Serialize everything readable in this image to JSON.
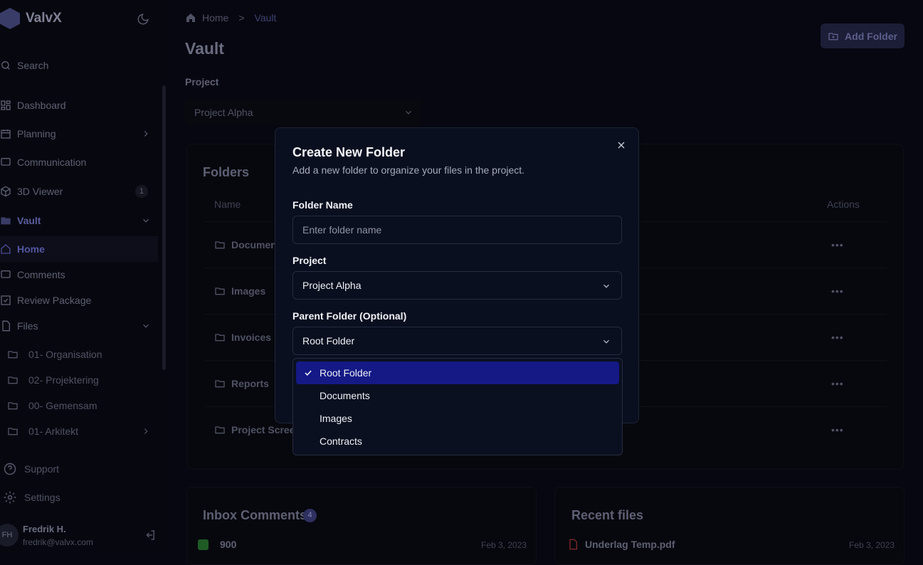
{
  "brand": {
    "name": "ValvX"
  },
  "sidebar": {
    "search_placeholder": "Search",
    "items": [
      {
        "label": "Dashboard"
      },
      {
        "label": "Planning"
      },
      {
        "label": "Communication"
      },
      {
        "label": "3D Viewer",
        "badge": "1"
      },
      {
        "label": "Vault"
      },
      {
        "label": "Home"
      },
      {
        "label": "Comments"
      },
      {
        "label": "Review Package"
      },
      {
        "label": "Files"
      }
    ],
    "file_folders": [
      {
        "label": "01- Organisation"
      },
      {
        "label": "02- Projektering"
      },
      {
        "label": "00- Gemensam"
      },
      {
        "label": "01- Arkitekt"
      }
    ],
    "footer": [
      {
        "label": "Support"
      },
      {
        "label": "Settings"
      }
    ],
    "user": {
      "initials": "FH",
      "name": "Fredrik H.",
      "email": "fredrik@valvx.com"
    }
  },
  "breadcrumb": {
    "home": "Home",
    "separator": ">",
    "current": "Vault"
  },
  "page": {
    "title": "Vault",
    "add_folder_label": "Add Folder",
    "project_label": "Project",
    "project_value": "Project Alpha"
  },
  "folders": {
    "title": "Folders",
    "col_name": "Name",
    "col_actions": "Actions",
    "rows": [
      {
        "name": "Documen"
      },
      {
        "name": "Images"
      },
      {
        "name": "Invoices"
      },
      {
        "name": "Reports"
      },
      {
        "name": "Project Screer"
      }
    ],
    "row_actions": "•••"
  },
  "inbox": {
    "title": "Inbox Comments",
    "count": "4",
    "rows": [
      {
        "text": "900",
        "date": "Feb 3, 2023"
      }
    ]
  },
  "recent": {
    "title": "Recent files",
    "rows": [
      {
        "text": "Underlag Temp.pdf",
        "date": "Feb 3, 2023"
      }
    ]
  },
  "modal": {
    "title": "Create New Folder",
    "subtitle": "Add a new folder to organize your files in the project.",
    "folder_name_label": "Folder Name",
    "folder_name_placeholder": "Enter folder name",
    "project_label": "Project",
    "project_value": "Project Alpha",
    "parent_label": "Parent Folder (Optional)",
    "parent_value": "Root Folder",
    "dropdown_options": [
      {
        "label": "Root Folder",
        "selected": true
      },
      {
        "label": "Documents"
      },
      {
        "label": "Images"
      },
      {
        "label": "Contracts"
      }
    ]
  },
  "colors": {
    "accent": "#141986",
    "modal_bg": "#0a0f1f",
    "page_bg": "#060710"
  }
}
